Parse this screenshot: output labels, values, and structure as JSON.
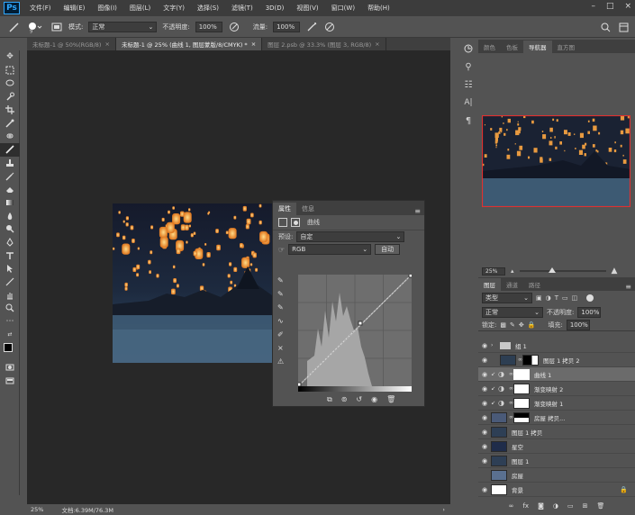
{
  "app": {
    "logo": "Ps"
  },
  "menu": [
    "文件(F)",
    "编辑(E)",
    "图像(I)",
    "图层(L)",
    "文字(Y)",
    "选择(S)",
    "滤镜(T)",
    "3D(D)",
    "视图(V)",
    "窗口(W)",
    "帮助(H)"
  ],
  "options": {
    "brush_size": "9",
    "mode_label": "模式:",
    "mode_value": "正常",
    "opacity_label": "不透明度:",
    "opacity_value": "100%",
    "flow_label": "流量:",
    "flow_value": "100%"
  },
  "tabs": [
    {
      "label": "未标题-1 @ 50%(RGB/8)",
      "close": "×"
    },
    {
      "label": "未标题-1 @ 25% (曲线 1, 图层蒙版/8/CMYK) *",
      "close": "×"
    },
    {
      "label": "图层 2.psb @ 33.3% (图层 3, RGB/8)",
      "close": "×"
    }
  ],
  "properties": {
    "tabs": [
      "属性",
      "信息"
    ],
    "title": "曲线",
    "preset_label": "预设:",
    "preset_value": "自定",
    "channel_value": "RGB",
    "auto_button": "自动"
  },
  "right_panels": {
    "nav_tabs": [
      "颜色",
      "色板",
      "导航器",
      "直方图"
    ],
    "zoom": "25%"
  },
  "layers_panel": {
    "tabs": [
      "图层",
      "通道",
      "路径"
    ],
    "filter": "类型",
    "blend_mode": "正常",
    "opacity_label": "不透明度:",
    "opacity_value": "100%",
    "lock_label": "锁定:",
    "fill_label": "填充:",
    "fill_value": "100%",
    "layers": [
      {
        "name": "组 1",
        "type": "group"
      },
      {
        "name": "图层 1 拷贝 2",
        "type": "masked"
      },
      {
        "name": "曲线 1",
        "type": "adjust",
        "selected": true
      },
      {
        "name": "渐变映射 2",
        "type": "adjust"
      },
      {
        "name": "渐变映射 1",
        "type": "adjust"
      },
      {
        "name": "房屋 拷贝...",
        "type": "masked2"
      },
      {
        "name": "图层 1 拷贝",
        "type": "image"
      },
      {
        "name": "星空",
        "type": "image"
      },
      {
        "name": "图层 1",
        "type": "image"
      },
      {
        "name": "房屋",
        "type": "image"
      },
      {
        "name": "背景",
        "type": "bg"
      }
    ]
  },
  "status": {
    "zoom": "25%",
    "doc": "文档:6.39M/76.3M"
  },
  "colors": {
    "bg": "#535353",
    "dark": "#282828",
    "accent": "#31a8ff",
    "nav_frame": "#e03030"
  }
}
